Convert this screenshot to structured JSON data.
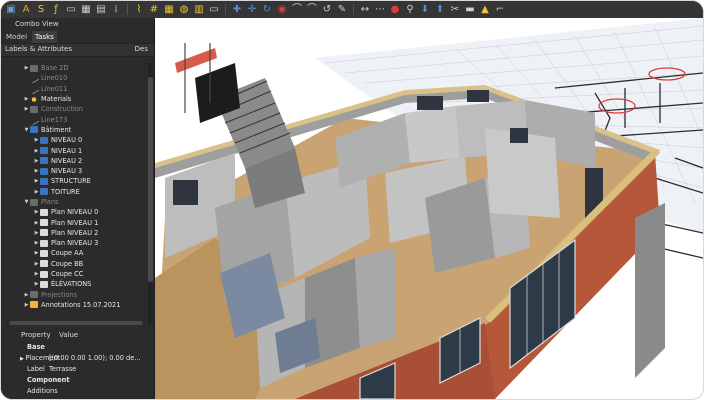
{
  "panel": {
    "title": "Combo View",
    "tabs": [
      "Model",
      "Tasks"
    ],
    "tree_header": {
      "left": "Labels & Attributes",
      "right": "Des"
    }
  },
  "tree": [
    {
      "label": "Base 2D",
      "indent": 1,
      "arrow": "right",
      "icon": "folder-dim",
      "dim": true
    },
    {
      "label": "Line010",
      "indent": 1,
      "arrow": "",
      "icon": "line",
      "dim": true
    },
    {
      "label": "Line011",
      "indent": 1,
      "arrow": "",
      "icon": "line",
      "dim": true
    },
    {
      "label": "Materials",
      "indent": 1,
      "arrow": "right",
      "icon": "materials",
      "dim": false
    },
    {
      "label": "Construction",
      "indent": 1,
      "arrow": "right",
      "icon": "folder-dim",
      "dim": true
    },
    {
      "label": "Line173",
      "indent": 1,
      "arrow": "",
      "icon": "line",
      "dim": true
    },
    {
      "label": "Bâtiment",
      "indent": 1,
      "arrow": "down",
      "icon": "building",
      "dim": false
    },
    {
      "label": "NIVEAU 0",
      "indent": 2,
      "arrow": "right",
      "icon": "level",
      "dim": false
    },
    {
      "label": "NIVEAU 1",
      "indent": 2,
      "arrow": "right",
      "icon": "level",
      "dim": false
    },
    {
      "label": "NIVEAU 2",
      "indent": 2,
      "arrow": "right",
      "icon": "level",
      "dim": false
    },
    {
      "label": "NIVEAU 3",
      "indent": 2,
      "arrow": "right",
      "icon": "level",
      "dim": false
    },
    {
      "label": "STRUCTURE",
      "indent": 2,
      "arrow": "right",
      "icon": "level",
      "dim": false
    },
    {
      "label": "TOITURE",
      "indent": 2,
      "arrow": "right",
      "icon": "level",
      "dim": false
    },
    {
      "label": "Plans",
      "indent": 1,
      "arrow": "down",
      "icon": "folder-dim",
      "dim": true
    },
    {
      "label": "Plan NIVEAU 0",
      "indent": 2,
      "arrow": "right",
      "icon": "plan",
      "dim": false
    },
    {
      "label": "Plan NIVEAU 1",
      "indent": 2,
      "arrow": "right",
      "icon": "plan",
      "dim": false
    },
    {
      "label": "Plan NIVEAU 2",
      "indent": 2,
      "arrow": "right",
      "icon": "plan",
      "dim": false
    },
    {
      "label": "Plan NIVEAU 3",
      "indent": 2,
      "arrow": "right",
      "icon": "plan",
      "dim": false
    },
    {
      "label": "Coupe AA",
      "indent": 2,
      "arrow": "right",
      "icon": "plan",
      "dim": false
    },
    {
      "label": "Coupe BB",
      "indent": 2,
      "arrow": "right",
      "icon": "plan",
      "dim": false
    },
    {
      "label": "Coupe CC",
      "indent": 2,
      "arrow": "right",
      "icon": "plan",
      "dim": false
    },
    {
      "label": "ÉLÉVATIONS",
      "indent": 2,
      "arrow": "right",
      "icon": "plan",
      "dim": false
    },
    {
      "label": "Projections",
      "indent": 1,
      "arrow": "right",
      "icon": "folder-dim",
      "dim": true
    },
    {
      "label": "Annotations 15.07.2021",
      "indent": 1,
      "arrow": "right",
      "icon": "folder",
      "dim": false
    }
  ],
  "properties": {
    "header": {
      "property": "Property",
      "value": "Value"
    },
    "rows": [
      {
        "type": "group",
        "label": "Base"
      },
      {
        "type": "prop",
        "name": "Placement",
        "value": "[(0.00 0.00 1.00); 0.00 de...",
        "expand": true
      },
      {
        "type": "prop",
        "name": "Label",
        "value": "Terrasse",
        "expand": false
      },
      {
        "type": "group",
        "label": "Component"
      },
      {
        "type": "prop",
        "name": "Additions",
        "value": "",
        "expand": false
      }
    ]
  },
  "toolbar_icons": [
    "view-icon",
    "text-icon",
    "shapestring-icon",
    "dimension-icon",
    "label-icon",
    "hatch-icon",
    "image-icon",
    "array-icon",
    "sep",
    "axis-icon",
    "grid-icon",
    "section-plane-icon",
    "structure-icon",
    "schedule-icon",
    "separator-icon",
    "sep",
    "move-icon",
    "axis-move-icon",
    "rotate-icon",
    "nav-cube-icon",
    "pipe-icon",
    "curved-icon",
    "refresh-icon",
    "sketch-icon",
    "sep",
    "snap-icon",
    "snap-grid-icon",
    "record-icon",
    "zoom-icon",
    "download-icon",
    "up-icon",
    "scissors-icon",
    "ruler-icon",
    "warning-icon",
    "measure-icon"
  ],
  "colors": {
    "panel_bg": "#2b2b2b",
    "accent_red": "#e03a3a",
    "accent_yellow": "#f2c230",
    "wall_orange": "#b35a3a"
  }
}
